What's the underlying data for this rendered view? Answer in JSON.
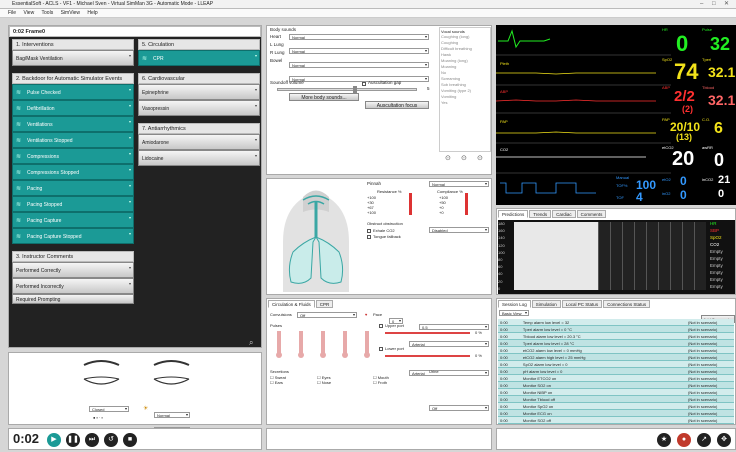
{
  "window": {
    "title": "EssentialSoft - ACLS - VF1 - Michael Sven - Virtual SimMan 3G - Automatic Mode - LLEAP"
  },
  "menu": [
    "File",
    "View",
    "Tools",
    "SimView",
    "Help"
  ],
  "frame_title": "0:02 Frame0",
  "events": {
    "interventions": {
      "header": "1. Interventions",
      "items": [
        "Bag/Mask Ventilation"
      ]
    },
    "backdoor": {
      "header": "2. Backdoor for Automatic Simulator Events",
      "items": [
        "Pulse Checked",
        "Defibrillation",
        "Ventilations",
        "Ventilations Stopped",
        "Compressions",
        "Compressions Stopped",
        "Pacing",
        "Pacing Stopped",
        "Pacing Capture",
        "Pacing Capture Stopped"
      ]
    },
    "instructor": {
      "header": "3. Instructor Comments",
      "items": [
        "Performed Correctly",
        "Performed Incorrectly",
        "Required Prompting"
      ]
    },
    "circulation": {
      "header": "5. Circulation",
      "items": [
        "CPR"
      ]
    },
    "cardiovascular": {
      "header": "6. Cardiovascular",
      "items": [
        "Epinephrine",
        "Vasopressin"
      ]
    },
    "antiarrhythmics": {
      "header": "7. Antiarrhythmics",
      "items": [
        "Amiodarone",
        "Lidocaine"
      ]
    }
  },
  "eyes": {
    "left_select": "Closed",
    "right_select": "Normal",
    "pupil_left": "Normal",
    "pupil_right": "Normal"
  },
  "body_sounds": {
    "title": "Body sounds",
    "rows": [
      {
        "label": "Heart",
        "value": "Normal"
      },
      {
        "label": "L Lung",
        "value": "Normal"
      },
      {
        "label": "R Lung",
        "value": "Normal"
      },
      {
        "label": "Bowel",
        "value": "Normal"
      }
    ],
    "more_button": "More body sounds...",
    "ausc_button": "Auscultation focus",
    "soundoff_label": "Soundoff volume",
    "ausc_gap_label": "Auscultation gap",
    "volume_value": "5",
    "vocal_title": "Vocal sounds",
    "vocal_items": [
      "Coughing (long)",
      "Coughing",
      "Difficult breathing",
      "Hawk",
      "Moaning (long)",
      "Moaning",
      "No",
      "Screaming",
      "Sob breathing",
      "Vomiting (type 2)",
      "Vomiting",
      "Yes"
    ],
    "more_sounds": "More sounds..."
  },
  "airway": {
    "pinnah_label": "Pinnah",
    "pinnah_value": "Normal",
    "resistance_label": "Resistance %",
    "compliance_label": "Compliance %",
    "resistance_vals": [
      "+100",
      "+30",
      "+67",
      "+100"
    ],
    "compliance_vals": [
      "+100",
      "+50",
      "+0",
      "+0"
    ],
    "obstruction_label": "Obstruct obstruction",
    "obstruction_value": "Disabled",
    "exhale_label": "Exhale CO2",
    "tongue_label": "Tongue fallback"
  },
  "circ_tabs": [
    "Circulation & Fluids",
    "CPR"
  ],
  "circ": {
    "convulsions_label": "Convulsions",
    "convulsions_value": "Off",
    "pulses_label": "Pulses",
    "pulse_value": "0",
    "pulse_select": "0.5",
    "upper_label": "Upper port",
    "upper_value": "Arterial",
    "lower_label": "Lower port",
    "lower_value": "Arterial",
    "secretions_label": "Secretions",
    "urine_label": "Urine",
    "urine_value": "Off",
    "secretions": [
      "Sweat",
      "Ears",
      "Eyes",
      "Nose",
      "Mouth",
      "Froth"
    ],
    "pct": [
      "0 %",
      "0 %"
    ]
  },
  "monitor": {
    "hr_label": "HR",
    "hr_value": "0",
    "pulse_label": "Pulse",
    "pulse_value": "32",
    "spo2_label": "SpO2",
    "spo2_value": "74",
    "tperi_label": "Tperi",
    "tperi_value": "32.1",
    "abp_label": "ABP",
    "abp_value": "2/2",
    "abp_sub": "(2)",
    "tblood_label": "Tblood",
    "tblood_value": "32.1",
    "pap_label": "PAP",
    "pap_value": "20/10",
    "pap_sub": "(13)",
    "co_label": "C.O.",
    "co_value": "6",
    "etco2_label": "etCO2",
    "etco2_value": "20",
    "awrr_label": "awRR",
    "awrr_value": "0",
    "tof_label": "TOF%",
    "tof_value": "100",
    "mode": "Manual",
    "tof_lbl2": "TOF",
    "tof_count": "4",
    "eto2_label": "etO2",
    "eto2_value": "0",
    "ino2_label": "inO2",
    "ino2_value": "0",
    "inco2_label": "inCO2",
    "inco2_value": "21",
    "in02b": "0",
    "pleth_label": "Pleth",
    "co2_label": "CO2"
  },
  "trend_tabs": [
    "Predictions",
    "Trends",
    "Cardiac",
    "Comments"
  ],
  "trend_legend": [
    "HR",
    "SBP",
    "SpO2",
    "CO2",
    "Empty",
    "Empty",
    "Empty",
    "Empty",
    "Empty",
    "Empty"
  ],
  "trend_yticks": [
    "180",
    "160",
    "140",
    "120",
    "100",
    "80",
    "60",
    "40",
    "20",
    "0"
  ],
  "log_tabs": [
    "Session Log",
    "Simulation",
    "Local PC Status",
    "Connections Status"
  ],
  "log_filter": "Basic View",
  "log_add": "Add Comment...",
  "log": [
    {
      "time": "0:00",
      "event": "Temp alarm low level = 32",
      "status": "(Not in scenario)"
    },
    {
      "time": "0:00",
      "event": "Tperi alarm low level = 0 °C",
      "status": "(Not in scenario)"
    },
    {
      "time": "0:00",
      "event": "Tblood alarm low level = 20.3 °C",
      "status": "(Not in scenario)"
    },
    {
      "time": "0:00",
      "event": "Tperi alarm low level = 28 °C",
      "status": "(Not in scenario)"
    },
    {
      "time": "0:00",
      "event": "etCO2 alarm low level = 0 mmHg",
      "status": "(Not in scenario)"
    },
    {
      "time": "0:00",
      "event": "etCO2 alarm high level = 25 mmHg",
      "status": "(Not in scenario)"
    },
    {
      "time": "0:00",
      "event": "SpO2 alarm low level = 0",
      "status": "(Not in scenario)"
    },
    {
      "time": "0:00",
      "event": "pH alarm low level = 0",
      "status": "(Not in scenario)"
    },
    {
      "time": "0:00",
      "event": "Monitor ETCO2 on",
      "status": "(Not in scenario)"
    },
    {
      "time": "0:00",
      "event": "Monitor SO2 on",
      "status": "(Not in scenario)"
    },
    {
      "time": "0:00",
      "event": "Monitor NIBP on",
      "status": "(Not in scenario)"
    },
    {
      "time": "0:00",
      "event": "Monitor Tblood off",
      "status": "(Not in scenario)"
    },
    {
      "time": "0:00",
      "event": "Monitor SpO2 on",
      "status": "(Not in scenario)"
    },
    {
      "time": "0:00",
      "event": "Monitor ECG on",
      "status": "(Not in scenario)"
    },
    {
      "time": "0:00",
      "event": "Monitor SO2 off",
      "status": "(Not in scenario)"
    }
  ],
  "timer": "0:02",
  "colors": {
    "teal": "#1b9a96",
    "monitor_bg": "#000000",
    "hr_green": "#22ee22",
    "spo2_yellow": "#f2e21a",
    "abp_red": "#ff3030",
    "pap_yellow": "#f2e21a",
    "etco2_white": "#ffffff",
    "tof_blue": "#3399ff"
  }
}
